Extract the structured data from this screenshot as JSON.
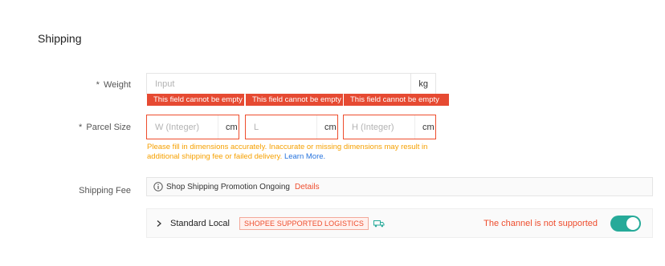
{
  "section": {
    "title": "Shipping"
  },
  "weight": {
    "label": "Weight",
    "required_mark": "*",
    "placeholder": "Input",
    "unit": "kg"
  },
  "parcel_size": {
    "label": "Parcel Size",
    "required_mark": "*",
    "fields": [
      {
        "placeholder": "W (Integer)",
        "unit": "cm",
        "error": "This field cannot be empty"
      },
      {
        "placeholder": "L",
        "unit": "cm",
        "error": "This field cannot be empty"
      },
      {
        "placeholder": "H (Integer)",
        "unit": "cm",
        "error": "This field cannot be empty"
      }
    ],
    "hint": "Please fill in dimensions accurately. Inaccurate or missing dimensions may result in additional shipping fee or failed delivery.",
    "hint_link": "Learn More."
  },
  "shipping_fee": {
    "label": "Shipping Fee",
    "promotion_text": "Shop Shipping Promotion Ongoing",
    "promotion_link": "Details",
    "channel": {
      "name": "Standard Local",
      "badge": "SHOPEE SUPPORTED LOGISTICS",
      "status": "The channel is not supported",
      "enabled": true
    }
  },
  "colors": {
    "accent": "#ee4d2d",
    "error_bg": "#e64a32",
    "warning": "#f6a000",
    "link": "#2673dd",
    "toggle_on": "#26aa99"
  }
}
